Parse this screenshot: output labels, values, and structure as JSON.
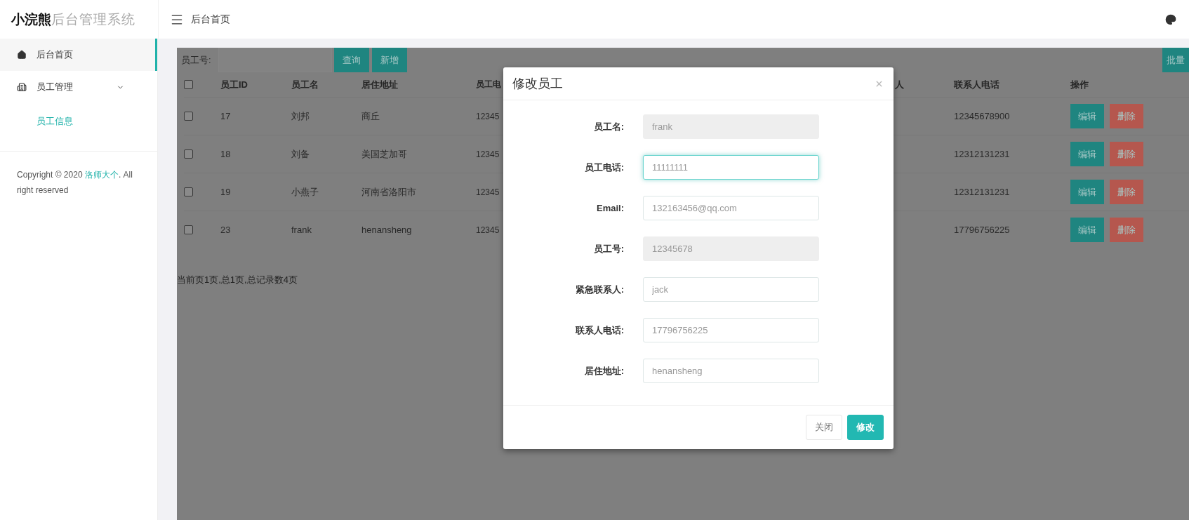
{
  "app": {
    "logo_bold": "小浣熊",
    "logo_light": "后台管理系统"
  },
  "header": {
    "breadcrumb": "后台首页"
  },
  "sidebar": {
    "items": [
      {
        "label": "后台首页",
        "kind": "home",
        "selected": true
      },
      {
        "label": "员工管理",
        "kind": "group",
        "selected": false,
        "expanded": true,
        "children": [
          {
            "label": "员工信息",
            "selected": true
          }
        ]
      }
    ],
    "copyright_before": "Copyright © 2020 ",
    "copyright_link": "洛师大个",
    "copyright_after": ". All right reserved"
  },
  "search": {
    "label": "员工号:",
    "buttons": [
      "查询",
      "新增"
    ],
    "batch_button": "批量"
  },
  "table": {
    "header_checked": false,
    "columns": {
      "id": "员工ID",
      "name": "员工名",
      "address": "居住地址",
      "phone": "员工电",
      "contact": "人",
      "contact_phone": "联系人电话",
      "actions": "操作"
    },
    "rows": [
      {
        "checked": false,
        "id": "17",
        "name": "刘邦",
        "address": "商丘",
        "phone": "12345",
        "contact_phone": "12345678900",
        "actions": [
          "编辑",
          "删除"
        ]
      },
      {
        "checked": false,
        "id": "18",
        "name": "刘备",
        "address": "美国芝加哥",
        "phone": "12345",
        "contact_phone": "12312131231",
        "actions": [
          "编辑",
          "删除"
        ]
      },
      {
        "checked": false,
        "id": "19",
        "name": "小燕子",
        "address": "河南省洛阳市",
        "phone": "12345",
        "contact_phone": "12312131231",
        "actions": [
          "编辑",
          "删除"
        ]
      },
      {
        "checked": false,
        "id": "23",
        "name": "frank",
        "address": "henansheng",
        "phone": "12345",
        "contact_phone": "17796756225",
        "actions": [
          "编辑",
          "删除"
        ]
      }
    ]
  },
  "pagination": "当前页1页,总1页,总记录数4页",
  "modal": {
    "title": "修改员工",
    "fields": [
      {
        "label": "员工名:",
        "value": "frank",
        "disabled": true,
        "focused": false
      },
      {
        "label": "员工电话:",
        "value": "11111111",
        "disabled": false,
        "focused": true
      },
      {
        "label": "Email:",
        "value": "132163456@qq.com",
        "disabled": false,
        "focused": false
      },
      {
        "label": "员工号:",
        "value": "12345678",
        "disabled": true,
        "focused": false
      },
      {
        "label": "紧急联系人:",
        "value": "jack",
        "disabled": false,
        "focused": false
      },
      {
        "label": "联系人电话:",
        "value": "17796756225",
        "disabled": false,
        "focused": false
      },
      {
        "label": "居住地址:",
        "value": "henansheng",
        "disabled": false,
        "focused": false
      }
    ],
    "buttons": [
      {
        "label": "关闭",
        "kind": "secondary"
      },
      {
        "label": "修改",
        "kind": "primary"
      }
    ]
  }
}
